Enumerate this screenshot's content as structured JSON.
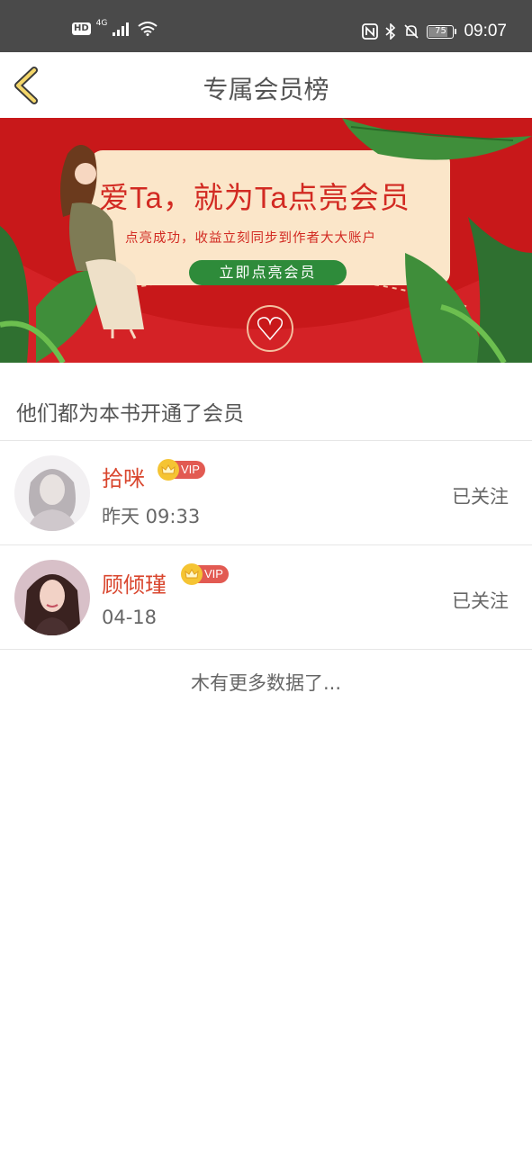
{
  "status_bar": {
    "hd": "HD",
    "network": "4G",
    "battery": "75",
    "battery_level": 0.75,
    "time": "09:07"
  },
  "header": {
    "title": "专属会员榜"
  },
  "banner": {
    "headline": "爱Ta，就为Ta点亮会员",
    "subline": "点亮成功，收益立刻同步到作者大大账户",
    "cta": "立即点亮会员",
    "colors": {
      "background": "#c8181a",
      "card": "#fbe6c9",
      "button": "#2e8b3a"
    }
  },
  "section": {
    "title": "他们都为本书开通了会员"
  },
  "members": [
    {
      "name": "拾咪",
      "vip": "VIP",
      "time": "昨天 09:33",
      "follow": "已关注"
    },
    {
      "name": "顾倾瑾",
      "vip": "VIP",
      "time": "04-18",
      "follow": "已关注"
    }
  ],
  "footer": {
    "no_more": "木有更多数据了..."
  },
  "colors": {
    "accent": "#d9462e",
    "vip": "#e25a52",
    "crown": "#f5c433"
  }
}
